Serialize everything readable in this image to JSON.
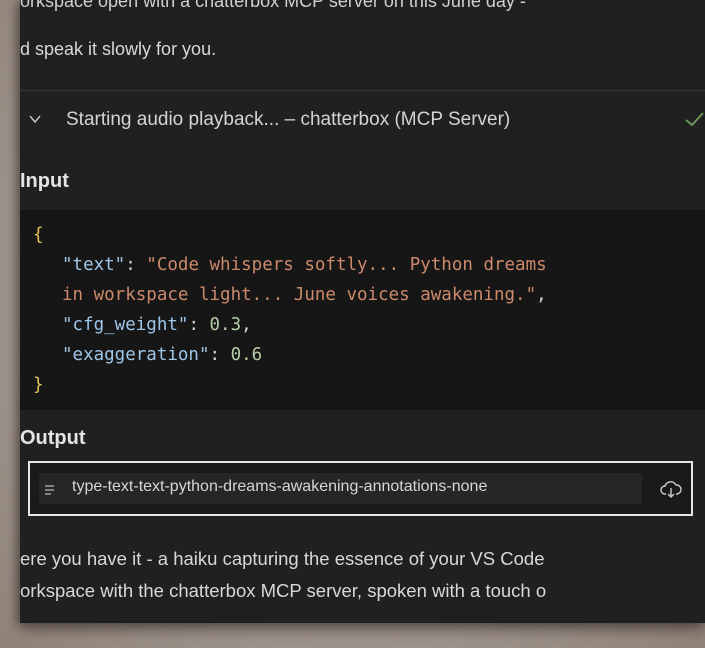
{
  "intro": {
    "line1": "orkspace open with a chatterbox MCP server on this June day -",
    "line2": "d speak it slowly for you."
  },
  "tool_call": {
    "title": "Starting audio playback... – chatterbox (MCP Server)",
    "status": "completed"
  },
  "input": {
    "label": "Input",
    "code_lines": [
      {
        "open": "{"
      },
      {
        "key": "\"text\"",
        "value": "\"Code whispers softly... Python dreams"
      },
      {
        "cont": "in workspace light... June voices awakening.\"",
        "tail": ","
      },
      {
        "key": "\"cfg_weight\"",
        "num": "0.3",
        "tail": ","
      },
      {
        "key": "\"exaggeration\"",
        "num": "0.6"
      },
      {
        "close": "}"
      }
    ]
  },
  "output": {
    "label": "Output",
    "resource_name": "type-text-text-python-dreams-awakening-annotations-none"
  },
  "outro": {
    "line1": "ere you have it - a haiku capturing the essence of your VS Code",
    "line2": "orkspace with the chatterbox MCP server, spoken with a touch o"
  },
  "icons": {
    "chevron": "chevron-down-icon",
    "check": "checkmark-icon",
    "resource": "text-lines-icon",
    "download": "cloud-download-icon"
  },
  "colors": {
    "background": "#202020",
    "code_background": "#161616",
    "json_key": "#9fc6e8",
    "json_string": "#cc8a6b",
    "json_number": "#b5cea8",
    "json_brace": "#e8c35a",
    "check": "#6a9955"
  }
}
